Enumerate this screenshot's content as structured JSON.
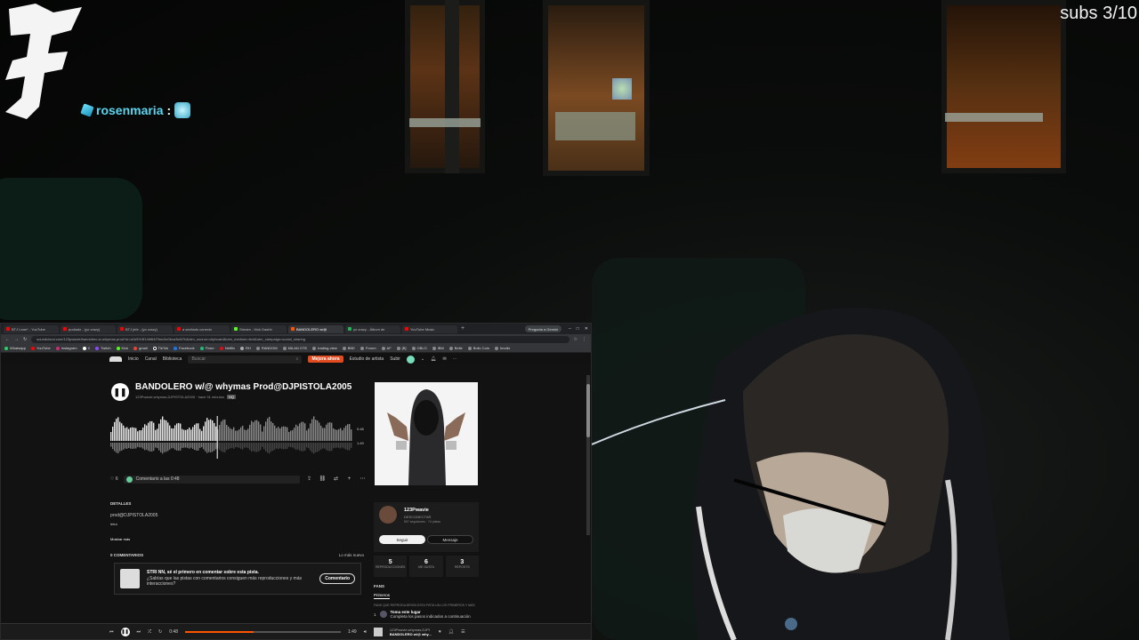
{
  "overlay": {
    "subs_counter": "subs 3/10",
    "chat": {
      "username": "rosenmaria",
      "separator": ":"
    }
  },
  "browser": {
    "tabs": [
      {
        "label": "BTJ Lean* - YouTube",
        "color": "#ff0000"
      },
      {
        "label": "pudiado - (yo crazy)",
        "color": "#ff0000"
      },
      {
        "label": "BTJ jefe - (yo crazy)",
        "color": "#ff0000"
      },
      {
        "label": "a sevilado conexio",
        "color": "#ff0000"
      },
      {
        "label": "Stream - Kick Dashb",
        "color": "#53fc18"
      },
      {
        "label": "BANDOLERO w/@",
        "color": "#ff5500",
        "active": true
      },
      {
        "label": "yo crazy - Álbum de",
        "color": "#1db954"
      },
      {
        "label": "YouTube Music",
        "color": "#ff0000"
      }
    ],
    "gemini_button": "Pregunta a Gemini",
    "url": "soundcloud.com/123pwavie/bandolero-w-whymas-prod?si=a1b5%3f14bf64f7bec5c0bca3af47b&utm_source=clipboard&utm_medium=text&utm_campaign=social_sharing",
    "bookmarks": [
      "Whatsapp",
      "YouTube",
      "Instagram",
      "X",
      "Twitch",
      "Kick",
      "gmail",
      "TikTok",
      "Facebook",
      "Fiverr",
      "Netflix",
      "RH",
      "RANDOM",
      "MILAN OTE",
      "trading-view",
      "BNE",
      "Forum",
      "AF",
      "[B]",
      "OBLO",
      "IBM",
      "Belle",
      "Bollo Coin",
      "Invoils"
    ]
  },
  "soundcloud": {
    "nav": [
      "Inicio",
      "Canal",
      "Biblioteca"
    ],
    "search_placeholder": "Buscar",
    "pro_button": "Mejora ahora",
    "artist_studio": "Estudio de artista",
    "upload": "Subir",
    "track": {
      "title": "BANDOLERO w/@ whymas Prod@DJPISTOLA2005",
      "subtitle": "123Pwavie,whymas,DJPISTOLA2005 · hace 31 minutos",
      "quality_badge": "HQ",
      "duration_current": "0:48",
      "duration_total": "1:49",
      "likes": "6",
      "comment_placeholder": "Comentario a las 0:48"
    },
    "details": {
      "heading": "DETALLES",
      "description": "prod@DJPISTOLA2005",
      "lyrics_label": "letra",
      "show_more": "Mostrar más"
    },
    "comments": {
      "heading": "0 COMENTARIOS",
      "sort": "Lo más nuevo",
      "prompt_title": "STRI NN, sé el primero en comentar sobre esta pista.",
      "prompt_body": "¿Sabías que las pistas con comentarios consiguen más reproducciones y más interacciones?",
      "button": "Comentario"
    },
    "artist": {
      "name": "123Pwavie",
      "role": "DESCONECTAR",
      "stats": "507 seguidores · 74 pistas",
      "follow": "Seguir",
      "message": "Mensaje"
    },
    "stats": [
      {
        "value": "5",
        "label": "REPRODUCCIONES"
      },
      {
        "value": "6",
        "label": "ME GUSTA"
      },
      {
        "value": "3",
        "label": "REPOSTS"
      }
    ],
    "fans": {
      "heading": "FANS",
      "tab": "Primeros",
      "note": "FANS QUE REPRODUJERON ESTA PISTA UN LOS PRIMEROS Y MÁS",
      "rank": "1",
      "cta_title": "Toma este lugar",
      "cta_body": "Completa los pasos indicados a continuación"
    },
    "player": {
      "elapsed": "0:48",
      "total": "1:49",
      "progress": 0.44,
      "artist": "123Pwavie,whymas,DJPI",
      "title": "BANDOLERO w/@ why..."
    }
  }
}
